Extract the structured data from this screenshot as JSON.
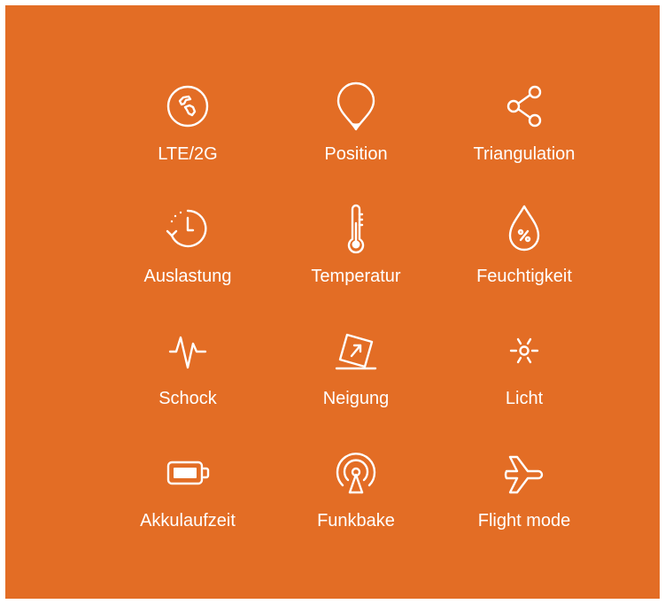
{
  "colors": {
    "background": "#E36D25",
    "foreground": "#FFFFFF"
  },
  "features": [
    {
      "icon": "globe-icon",
      "label": "LTE/2G"
    },
    {
      "icon": "location-pin-icon",
      "label": "Position"
    },
    {
      "icon": "share-nodes-icon",
      "label": "Triangulation"
    },
    {
      "icon": "clock-history-icon",
      "label": "Auslastung"
    },
    {
      "icon": "thermometer-icon",
      "label": "Temperatur"
    },
    {
      "icon": "drop-percent-icon",
      "label": "Feuchtigkeit"
    },
    {
      "icon": "pulse-icon",
      "label": "Schock"
    },
    {
      "icon": "tilt-arrow-icon",
      "label": "Neigung"
    },
    {
      "icon": "light-sun-icon",
      "label": "Licht"
    },
    {
      "icon": "battery-icon",
      "label": "Akkulaufzeit"
    },
    {
      "icon": "beacon-signal-icon",
      "label": "Funkbake"
    },
    {
      "icon": "airplane-icon",
      "label": "Flight mode"
    }
  ]
}
